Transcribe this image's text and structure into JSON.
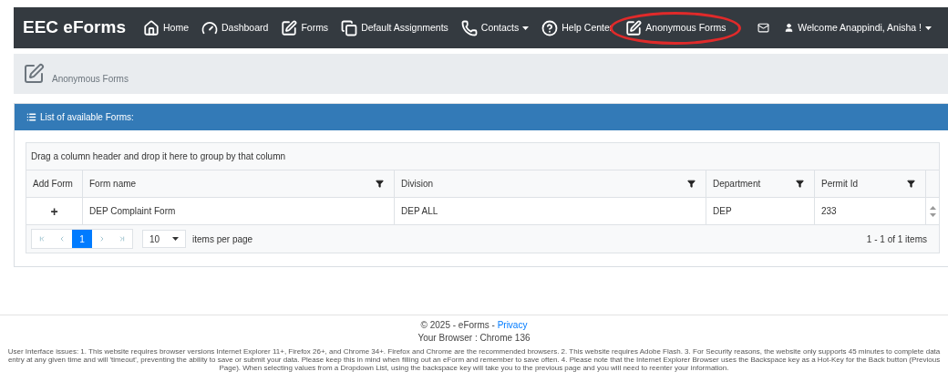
{
  "navbar": {
    "brand": "EEC eForms",
    "items": [
      {
        "label": "Home",
        "has_menu": false,
        "highlighted": false
      },
      {
        "label": "Dashboard",
        "has_menu": false,
        "highlighted": false
      },
      {
        "label": "Forms",
        "has_menu": false,
        "highlighted": false
      },
      {
        "label": "Default Assignments",
        "has_menu": false,
        "highlighted": false
      },
      {
        "label": "Contacts",
        "has_menu": true,
        "highlighted": false
      },
      {
        "label": "Help Center",
        "has_menu": false,
        "highlighted": false
      },
      {
        "label": "Anonymous Forms",
        "has_menu": false,
        "highlighted": true
      }
    ],
    "user": {
      "label": "Welcome Anappindi, Anisha !",
      "has_menu": true
    }
  },
  "breadcrumb": {
    "title": "Anonymous Forms"
  },
  "panel": {
    "title": "List of available Forms:",
    "grid": {
      "group_hint": "Drag a column header and drop it here to group by that column",
      "columns": [
        {
          "label": "Add Form",
          "filterable": false
        },
        {
          "label": "Form name",
          "filterable": true
        },
        {
          "label": "Division",
          "filterable": true
        },
        {
          "label": "Department",
          "filterable": true
        },
        {
          "label": "Permit Id",
          "filterable": true
        }
      ],
      "rows": [
        {
          "cells": [
            "+",
            "DEP Complaint Form",
            "DEP ALL",
            "DEP",
            "233"
          ]
        }
      ],
      "pager": {
        "pages": [
          {
            "label": "1",
            "selected": true
          }
        ],
        "page_size": "10",
        "page_size_label": "items per page",
        "summary": "1 - 1 of 1 items"
      }
    }
  },
  "footer": {
    "copyright": "© 2025 - eForms - ",
    "privacy_link": "Privacy",
    "browser": "Your Browser : Chrome 136",
    "disclaimer": "User Interface issues: 1. This website requires browser versions Internet Explorer 11+, Firefox 26+, and Chrome 34+. Firefox and Chrome are the recommended browsers. 2. This website requires Adobe Flash. 3. For Security reasons, the website only supports 45 minutes to complete data entry at any given time and will 'timeout', preventing the ability to save or submit your data. Please keep this in mind when filling out an eForm and remember to save often. 4. Please note that the Internet Explorer Browser uses the Backspace key as a Hot-Key for the Back button (Previous Page). When selecting values from a Dropdown List, using the backspace key will take you to the previous page and you will need to reenter your information."
  }
}
